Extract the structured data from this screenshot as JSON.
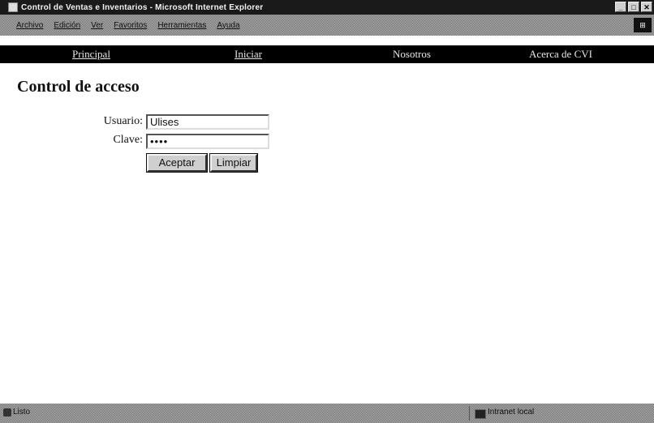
{
  "window": {
    "title": "Control de Ventas e Inventarios - Microsoft Internet Explorer",
    "buttons": [
      "_",
      "□",
      "✕"
    ]
  },
  "menubar": {
    "items": [
      "Archivo",
      "Edición",
      "Ver",
      "Favoritos",
      "Herramientas",
      "Ayuda"
    ],
    "right_icon": "windows-logo-icon"
  },
  "navbar": {
    "links": [
      "Principal",
      "Iniciar",
      "Nosotros",
      "Acerca de CVI"
    ]
  },
  "main": {
    "title": "Control de acceso",
    "username_label": "Usuario:",
    "username_value": "Ulises",
    "password_label": "Clave:",
    "password_value": "••••",
    "accept_label": "Aceptar",
    "clear_label": "Limpiar"
  },
  "statusbar": {
    "status": "Listo",
    "zone": "Intranet local"
  },
  "colors": {
    "navbar_bg": "#000000",
    "titlebar_bg": "#1a1a1a"
  }
}
